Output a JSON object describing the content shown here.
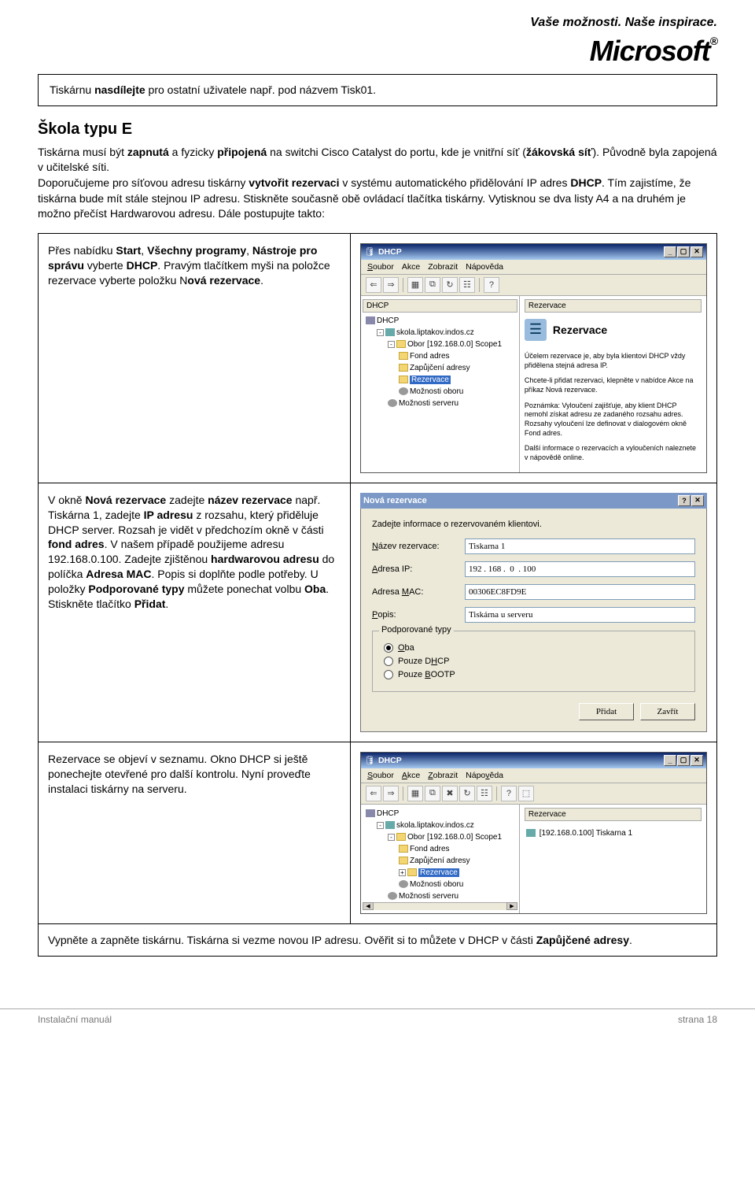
{
  "header": {
    "tagline": "Vaše možnosti. Naše inspirace.",
    "brand": "Microsoft",
    "reg": "®"
  },
  "box1": {
    "text_a": "Tiskárnu ",
    "b1": "nasdílejte",
    "text_b": " pro ostatní uživatele např. pod názvem Tisk01."
  },
  "sect_heading": "Škola typu E",
  "intro": {
    "a": "Tiskárna musí být ",
    "b1": "zapnutá",
    "b": " a fyzicky ",
    "b2": "připojená",
    "c": " na switchi Cisco Catalyst do portu, kde je vnitřní síť (",
    "b3": "žákovská síť",
    "d": "). Původně byla zapojená v učitelské síti.",
    "e": "Doporučujeme pro síťovou adresu tiskárny ",
    "b4": "vytvořit rezervaci",
    "f": " v systému automatického přidělování IP adres ",
    "b5": "DHCP",
    "g": ". Tím zajistíme, že tiskárna bude mít stále stejnou IP adresu. Stiskněte současně obě ovládací tlačítka tiskárny. Vytisknou se dva listy A4 a na druhém je možno přečíst Hardwarovou adresu. Dále postupujte takto:"
  },
  "row1": {
    "text_a": "Přes nabídku ",
    "b1": "Start",
    "comma1": ", ",
    "b2": "Všechny programy",
    "comma2": ", ",
    "b3": "Nástroje pro správu",
    "text_b": " vyberte ",
    "b4": "DHCP",
    "text_c": ". Pravým tlačítkem myši na položce rezervace vyberte položku N",
    "b5": "ová rezervace",
    "dot": "."
  },
  "dhcp": {
    "title": "DHCP",
    "menu": {
      "soubor": "Soubor",
      "akce": "Akce",
      "zobrazit": "Zobrazit",
      "napoveda": "Nápověda"
    },
    "server": "skola.liptakov.indos.cz",
    "scope": "Obor [192.168.0.0] Scope1",
    "fond": "Fond adres",
    "zap": "Zapůjčení adresy",
    "rez": "Rezervace",
    "mozo": "Možnosti oboru",
    "mozs": "Možnosti serveru",
    "pane_hd": "Rezervace",
    "big": "Rezervace",
    "p1": "Účelem rezervace je, aby byla klientovi DHCP vždy přidělena stejná adresa IP.",
    "p2": "Chcete-li přidat rezervaci, klepněte v nabídce Akce na příkaz Nová rezervace.",
    "p3": "Poznámka: Vyloučení zajišťuje, aby klient DHCP nemohl získat adresu ze zadaného rozsahu adres. Rozsahy vyloučení lze definovat v dialogovém okně Fond adres.",
    "p4": "Další informace o rezervacích a vyloučeních naleznete v nápovědě online.",
    "list_item": "[192.168.0.100] Tiskarna 1"
  },
  "row2": {
    "a": "V okně ",
    "b1": "Nová rezervace",
    "b": " zadejte ",
    "b2": "název rezervace",
    "c": " např. Tiskárna 1, zadejte ",
    "b3": "IP adresu",
    "d": " z rozsahu, který přiděluje DHCP server. Rozsah je vidět v předchozím okně v části ",
    "b4": "fond adres",
    "e": ". V našem případě použijeme adresu 192.168.0.100. Zadejte zjištěnou ",
    "b5": "hardwarovou adresu",
    "f": " do políčka ",
    "b6": "Adresa MAC",
    "g": ". Popis si doplňte podle potřeby. U položky ",
    "b7": "Podporované typy",
    "h": " můžete ponechat volbu ",
    "b8": "Oba",
    "i": ". Stiskněte tlačítko ",
    "b9": "Přidat",
    "dot": "."
  },
  "dlg": {
    "title": "Nová rezervace",
    "intro": "Zadejte informace o rezervovaném klientovi.",
    "l_name": "Název rezervace:",
    "v_name": "Tiskarna 1",
    "l_ip": "Adresa IP:",
    "v_ip": "192 . 168 .  0  . 100",
    "l_mac": "Adresa MAC:",
    "v_mac": "00306EC8FD9E",
    "l_desc": "Popis:",
    "v_desc": "Tiskárna u serveru",
    "grp": "Podporované typy",
    "r1": "Oba",
    "r2": "Pouze DHCP",
    "r3": "Pouze BOOTP",
    "btn_add": "Přidat",
    "btn_close": "Zavřít"
  },
  "row3": {
    "text": "Rezervace se objeví v seznamu. Okno DHCP si ještě ponechejte otevřené pro další kontrolu. Nyní proveďte instalaci tiskárny na serveru."
  },
  "row4": {
    "a": "Vypněte a zapněte tiskárnu. Tiskárna si vezme novou IP adresu. Ověřit si to můžete v DHCP v části ",
    "b": "Zapůjčené adresy",
    "dot": "."
  },
  "footer": {
    "left": "Instalační manuál",
    "right": "strana 18"
  }
}
